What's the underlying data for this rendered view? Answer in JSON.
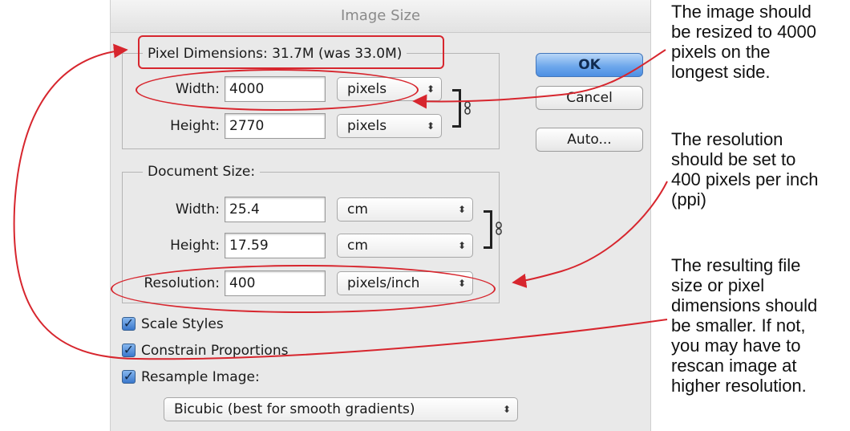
{
  "dialog": {
    "title": "Image Size",
    "pixel_dimensions": {
      "label": "Pixel Dimensions:",
      "value": "31.7M (was 33.0M)",
      "width": {
        "label": "Width:",
        "value": "4000",
        "unit": "pixels"
      },
      "height": {
        "label": "Height:",
        "value": "2770",
        "unit": "pixels"
      }
    },
    "document_size": {
      "label": "Document Size:",
      "width": {
        "label": "Width:",
        "value": "25.4",
        "unit": "cm"
      },
      "height": {
        "label": "Height:",
        "value": "17.59",
        "unit": "cm"
      },
      "resolution": {
        "label": "Resolution:",
        "value": "400",
        "unit": "pixels/inch"
      }
    },
    "buttons": {
      "ok": "OK",
      "cancel": "Cancel",
      "auto": "Auto..."
    },
    "options": {
      "scale_styles": {
        "label": "Scale Styles",
        "checked": true
      },
      "constrain_proportions": {
        "label": "Constrain Proportions",
        "checked": true
      },
      "resample_image": {
        "label": "Resample Image:",
        "checked": true
      }
    },
    "resample_method": "Bicubic (best for smooth gradients)"
  },
  "annotations": {
    "note_1": "The image should\nbe resized to 4000\npixels on the\nlongest side.",
    "note_2": "The resolution\nshould be set to\n400 pixels per inch\n(ppi)",
    "note_3": "The resulting file\nsize or pixel\ndimensions should\nbe smaller. If not,\nyou may have to\nrescan image at\nhigher resolution.",
    "highlight_color": "#d7262e"
  }
}
